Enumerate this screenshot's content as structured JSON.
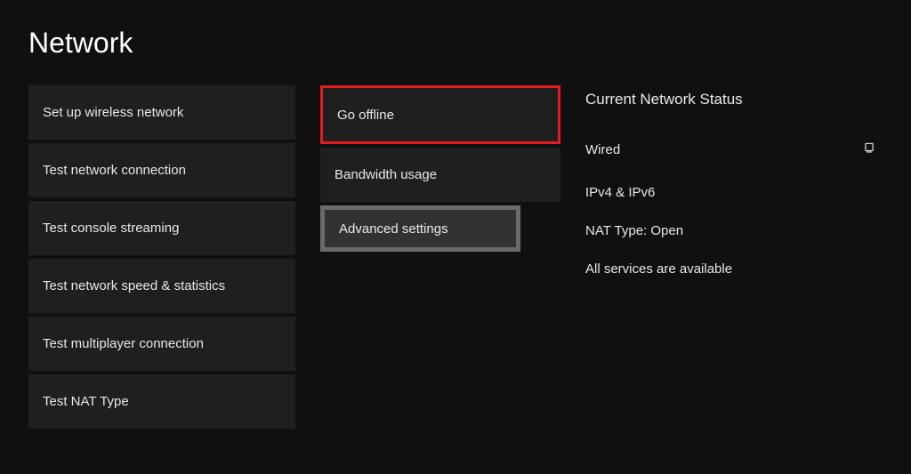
{
  "title": "Network",
  "left_column": {
    "items": [
      "Set up wireless network",
      "Test network connection",
      "Test console streaming",
      "Test network speed & statistics",
      "Test multiplayer connection",
      "Test NAT Type"
    ]
  },
  "middle_column": {
    "items": [
      {
        "label": "Go offline",
        "highlight": "red"
      },
      {
        "label": "Bandwidth usage",
        "highlight": null
      },
      {
        "label": "Advanced settings",
        "highlight": "grey"
      }
    ]
  },
  "status": {
    "heading": "Current Network Status",
    "connection_type": "Wired",
    "ip_protocol": "IPv4 & IPv6",
    "nat": "NAT Type: Open",
    "services": "All services are available"
  }
}
